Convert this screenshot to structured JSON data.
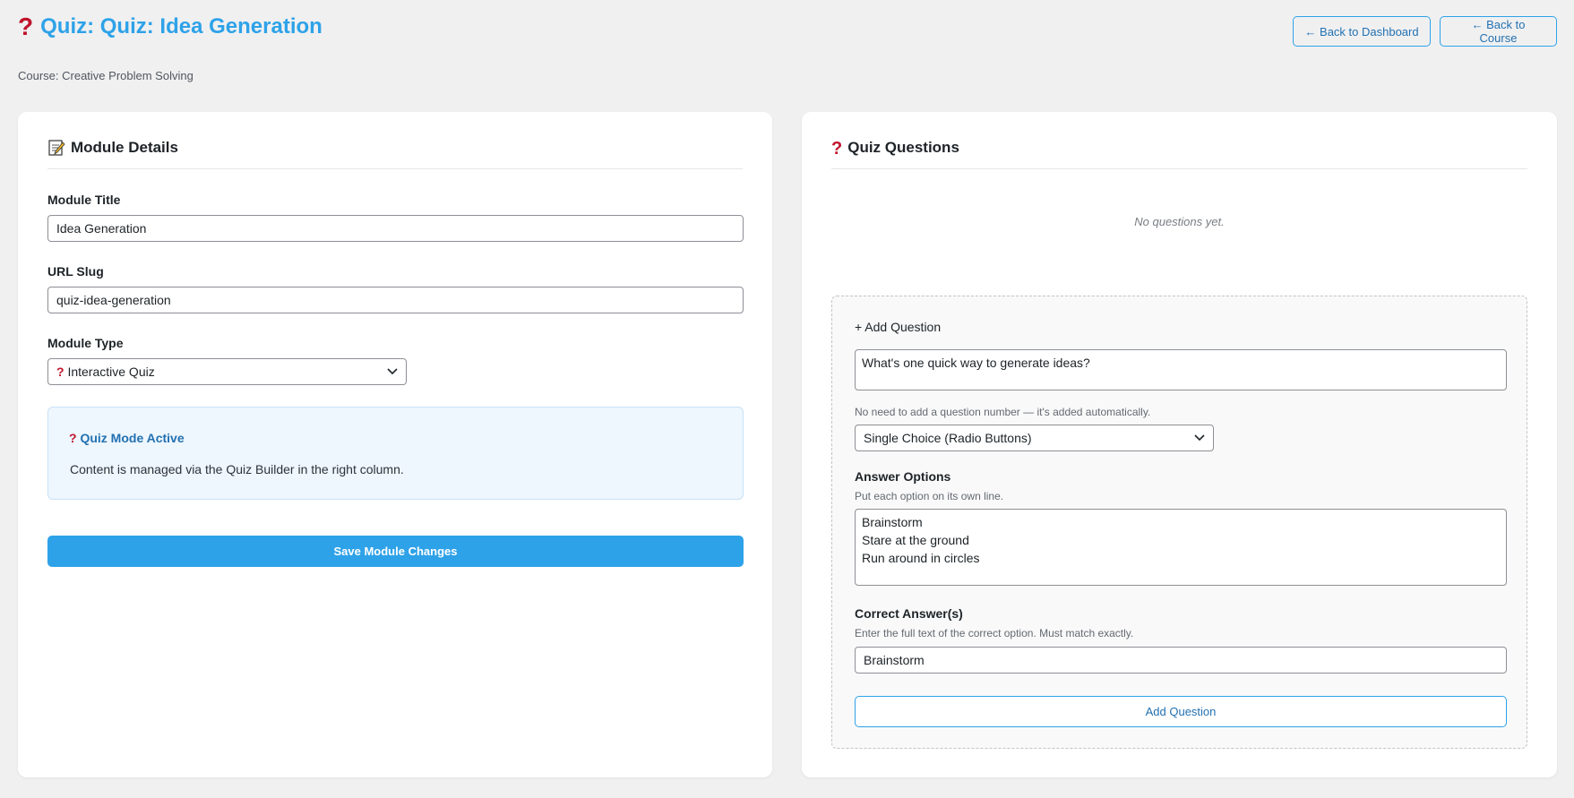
{
  "header": {
    "icon": "question-mark-icon",
    "title": "Quiz: Quiz: Idea Generation",
    "course_line": "Course: Creative Problem Solving",
    "back_dashboard": "← Back to Dashboard",
    "back_course": "← Back to Course"
  },
  "module_details": {
    "icon": "memo-icon",
    "heading": "Module Details",
    "title_label": "Module Title",
    "title_value": "Idea Generation",
    "slug_label": "URL Slug",
    "slug_value": "quiz-idea-generation",
    "type_label": "Module Type",
    "type_value": "Interactive Quiz",
    "notice_title": "Quiz Mode Active",
    "notice_text": "Content is managed via the Quiz Builder in the right column.",
    "save_label": "Save Module Changes"
  },
  "quiz_questions": {
    "heading": "Quiz Questions",
    "empty_message": "No questions yet.",
    "add_heading": "+ Add Question",
    "question_text": "What's one quick way to generate ideas?",
    "question_hint": "No need to add a question number — it's added automatically.",
    "question_type": "Single Choice (Radio Buttons)",
    "options_label": "Answer Options",
    "options_hint": "Put each option on its own line.",
    "options_text": "Brainstorm\nStare at the ground\nRun around in circles",
    "correct_label": "Correct Answer(s)",
    "correct_hint": "Enter the full text of the correct option. Must match exactly.",
    "correct_value": "Brainstorm",
    "add_button": "Add Question"
  },
  "colors": {
    "accent": "#2ea2e8",
    "link": "#2271b1",
    "background": "#f0f0f1",
    "question_icon": "#c0142b"
  }
}
